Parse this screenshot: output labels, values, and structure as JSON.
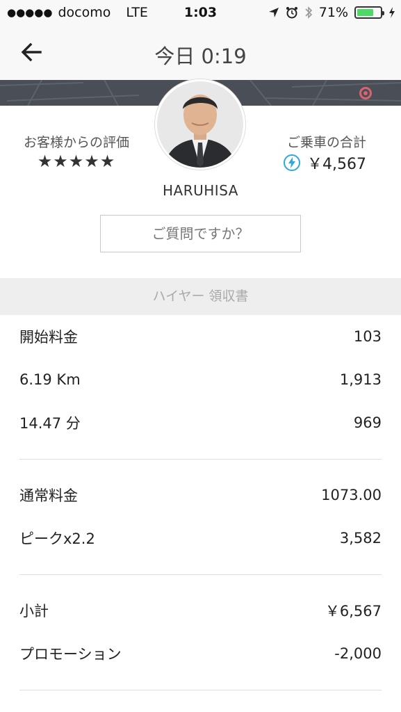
{
  "status_bar": {
    "signal": "●●●●●",
    "carrier": "docomo",
    "network": "LTE",
    "time": "1:03",
    "battery": "71%",
    "battery_level": 0.71
  },
  "nav": {
    "title": "今日 0:19"
  },
  "profile": {
    "rating_label": "お客様からの評価",
    "stars": "★★★★★",
    "total_label": "ご乗車の合計",
    "total_value": "￥4,567",
    "driver_name": "HARUHISA",
    "question_button": "ご質問ですか？"
  },
  "receipt": {
    "header": "ハイヤー 領収書",
    "groups": [
      [
        {
          "label": "開始料金",
          "value": "103"
        },
        {
          "label": "6.19 Km",
          "value": "1,913"
        },
        {
          "label": "14.47 分",
          "value": "969"
        }
      ],
      [
        {
          "label": "通常料金",
          "value": "1073.00"
        },
        {
          "label": "ピークx2.2",
          "value": "3,582"
        }
      ],
      [
        {
          "label": "小計",
          "value": "￥6,567"
        },
        {
          "label": "プロモーション",
          "value": "-2,000"
        }
      ]
    ]
  },
  "colors": {
    "battery_fill": "#4cd964",
    "bolt": "#2aa8e0",
    "map": "#4a4f57",
    "pin": "#d9646f"
  }
}
